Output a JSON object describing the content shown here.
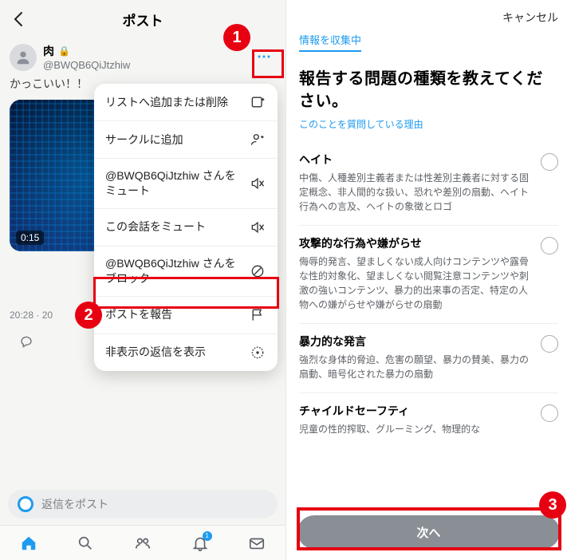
{
  "left": {
    "header_title": "ポスト",
    "user": {
      "display_name": "肉",
      "handle": "@BWQB6QiJtzhiw"
    },
    "tweet_text": "かっこいい！！",
    "media_duration": "0:15",
    "timestamp": "20:28 · 20",
    "reply_placeholder": "返信をポスト",
    "notif_badge": "1",
    "menu": {
      "add_list": "リストへ追加または削除",
      "add_circle": "サークルに追加",
      "mute_user": "@BWQB6QiJtzhiw さんをミュート",
      "mute_convo": "この会話をミュート",
      "block_user": "@BWQB6QiJtzhiw さんをブロック",
      "report_post": "ポストを報告",
      "show_hidden": "非表示の返信を表示"
    }
  },
  "right": {
    "cancel": "キャンセル",
    "step_label": "情報を収集中",
    "headline": "報告する問題の種類を教えてください。",
    "why_link": "このことを質問している理由",
    "options": [
      {
        "title": "ヘイト",
        "desc": "中傷、人種差別主義者または性差別主義者に対する固定概念、非人間的な扱い、恐れや差別の扇動、ヘイト行為への言及、ヘイトの象徴とロゴ"
      },
      {
        "title": "攻撃的な行為や嫌がらせ",
        "desc": "侮辱的発言、望ましくない成人向けコンテンツや露骨な性的対象化、望ましくない閲覧注意コンテンツや刺激の強いコンテンツ、暴力的出来事の否定、特定の人物への嫌がらせや嫌がらせの扇動"
      },
      {
        "title": "暴力的な発言",
        "desc": "強烈な身体的脅迫、危害の願望、暴力の賛美、暴力の扇動、暗号化された暴力の扇動"
      },
      {
        "title": "チャイルドセーフティ",
        "desc": "児童の性的搾取、グルーミング、物理的な"
      }
    ],
    "next_label": "次へ"
  },
  "annotations": {
    "n1": "1",
    "n2": "2",
    "n3": "3"
  }
}
